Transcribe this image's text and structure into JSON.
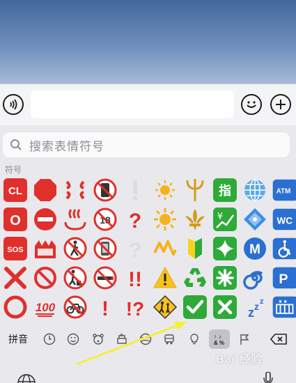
{
  "search": {
    "placeholder": "搜索表情符号"
  },
  "section": {
    "label": "符号"
  },
  "tabs": {
    "pinyin_label": "拼音",
    "icons": [
      "recent-clock-icon",
      "smiley-icon",
      "animal-icon",
      "food-icon",
      "activity-ball-icon",
      "travel-car-icon",
      "lightbulb-icon",
      "symbols-icon",
      "flag-icon",
      "backspace-icon"
    ],
    "active": "symbols-icon"
  },
  "emoji_grid": {
    "columns": 10,
    "rows": [
      [
        "CL",
        "stop-sign",
        "anger",
        "no-phones",
        "white-exclamation",
        "dim-sun",
        "trident",
        "指",
        "globe-meridians",
        "ATM"
      ],
      [
        "O",
        "no-entry",
        "hot-springs",
        "no-under-18",
        "red-question",
        "bright-sun",
        "fleur-de-lis",
        "yen-chart",
        "diamond-dot",
        "WC"
      ],
      [
        "SOS",
        "100-crown",
        "no-pedestrians",
        "no-mobile",
        "white-question",
        "part-alternation",
        "beginner",
        "sparkle",
        "M",
        "wheelchair"
      ],
      [
        "cross-mark",
        "prohibited",
        "no-littering",
        "no-smoking",
        "double-exclamation",
        "warning",
        "recycle",
        "eight-spoke",
        "cyclone",
        "P"
      ],
      [
        "hollow-circle",
        "100",
        "no-bicycles",
        "exclamation",
        "exclamation-question",
        "children-crossing",
        "check-mark-button",
        "cross-mark-button",
        "zzz",
        "passport-control"
      ]
    ],
    "text_labels": {
      "CL": "CL",
      "O": "O",
      "SOS": "SOS",
      "ATM": "ATM",
      "WC": "WC",
      "M": "M",
      "P": "P",
      "zh": "指",
      "hundred": "100",
      "zzz": "z",
      "exclam": "!",
      "dexclam": "!!",
      "qexclam": "!?",
      "question": "?"
    }
  },
  "colors": {
    "accent_red": "#e0302b",
    "accent_green": "#2eaa38",
    "accent_blue": "#2a6fd1",
    "highlight_arrow": "#f7ee3b"
  },
  "watermark": {
    "text": "Bai 经验"
  }
}
